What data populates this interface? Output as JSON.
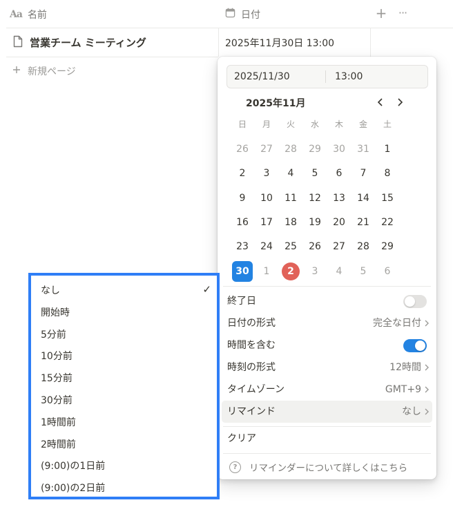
{
  "header": {
    "name_col": "名前",
    "name_icon": "Aa",
    "date_col": "日付",
    "add_icon": "+",
    "more_icon": "···"
  },
  "row": {
    "title": "営業チーム ミーティング",
    "date": "2025年11月30日 13:00"
  },
  "new_page": "新規ページ",
  "picker": {
    "date_value": "2025/11/30",
    "time_value": "13:00",
    "month_label": "2025年11月",
    "weekdays": [
      "日",
      "月",
      "火",
      "水",
      "木",
      "金",
      "土"
    ],
    "weeks": [
      [
        "26",
        "27",
        "28",
        "29",
        "30",
        "31",
        "1"
      ],
      [
        "2",
        "3",
        "4",
        "5",
        "6",
        "7",
        "8"
      ],
      [
        "9",
        "10",
        "11",
        "12",
        "13",
        "14",
        "15"
      ],
      [
        "16",
        "17",
        "18",
        "19",
        "20",
        "21",
        "22"
      ],
      [
        "23",
        "24",
        "25",
        "26",
        "27",
        "28",
        "29"
      ],
      [
        "30",
        "1",
        "2",
        "3",
        "4",
        "5",
        "6"
      ]
    ],
    "options": {
      "end_date": "終了日",
      "date_format": "日付の形式",
      "date_format_value": "完全な日付",
      "include_time": "時間を含む",
      "time_format": "時刻の形式",
      "time_format_value": "12時間",
      "timezone": "タイムゾーン",
      "timezone_value": "GMT+9",
      "remind": "リマインド",
      "remind_value": "なし",
      "clear": "クリア"
    },
    "end_date_enabled": false,
    "include_time_enabled": true,
    "help_text": "リマインダーについて詳しくはこちら"
  },
  "remind_menu": {
    "items": [
      "なし",
      "開始時",
      "5分前",
      "10分前",
      "15分前",
      "30分前",
      "1時間前",
      "2時間前",
      "(9:00)の1日前",
      "(9:00)の2日前"
    ],
    "selected": "なし",
    "check": "✓"
  },
  "colors": {
    "accent": "#2383e2",
    "today": "#e16259",
    "highlight_box": "#2f7ef6"
  }
}
